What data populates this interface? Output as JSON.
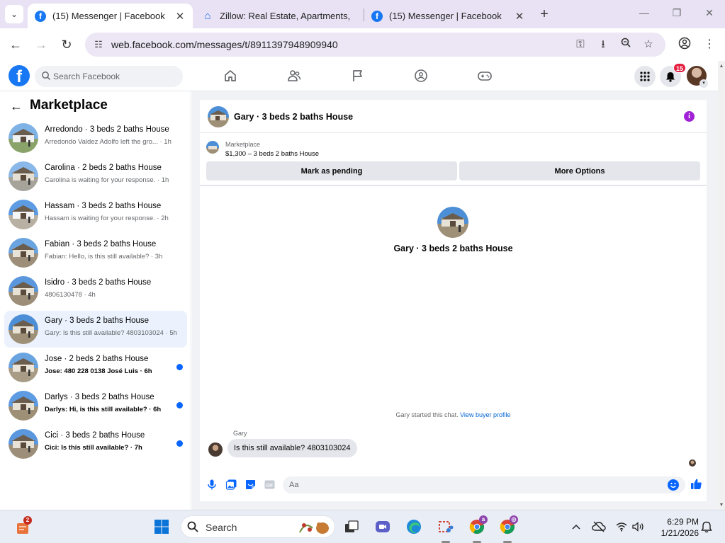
{
  "browser": {
    "tabs": [
      {
        "title": "(15) Messenger | Facebook",
        "icon": "facebook-icon",
        "active": true
      },
      {
        "title": "Zillow: Real Estate, Apartments,",
        "icon": "zillow-icon",
        "active": false
      },
      {
        "title": "(15) Messenger | Facebook",
        "icon": "facebook-icon",
        "active": false
      }
    ],
    "url": "web.facebook.com/messages/t/8911397948909940"
  },
  "header": {
    "logo": "f",
    "search_placeholder": "Search Facebook",
    "notification_count": "15"
  },
  "sidebar": {
    "title": "Marketplace",
    "conversations": [
      {
        "name": "Arredondo · 3 beds 2 baths House",
        "preview": "Arredondo Valdez Adolfo left the gro... · 1h",
        "unread": false,
        "selected": false
      },
      {
        "name": "Carolina · 2 beds 2 baths House",
        "preview": "Carolina is waiting for your response. · 1h",
        "unread": false,
        "selected": false
      },
      {
        "name": "Hassam · 3 beds 2 baths House",
        "preview": "Hassam is waiting for your response. · 2h",
        "unread": false,
        "selected": false
      },
      {
        "name": "Fabian · 3 beds 2 baths House",
        "preview": "Fabian: Hello, is this still available? · 3h",
        "unread": false,
        "selected": false
      },
      {
        "name": "Isidro · 3 beds 2 baths House",
        "preview": "4806130478 · 4h",
        "unread": false,
        "selected": false
      },
      {
        "name": "Gary · 3 beds 2 baths House",
        "preview": "Gary: Is this still available? 4803103024 · 5h",
        "unread": false,
        "selected": true
      },
      {
        "name": "Jose · 2 beds 2 baths House",
        "preview": "Jose: 480 228 0138 José Luis · 6h",
        "unread": true,
        "selected": false
      },
      {
        "name": "Darlys · 3 beds 2 baths House",
        "preview": "Darlys: Hi, is this still available? · 6h",
        "unread": true,
        "selected": false
      },
      {
        "name": "Cici · 3 beds 2 baths House",
        "preview": "Cici: Is this still available? · 7h",
        "unread": true,
        "selected": false
      }
    ]
  },
  "chat": {
    "title": "Gary · 3 beds 2 baths House",
    "listing_source": "Marketplace",
    "listing_price": "$1,300 – 3 beds 2 baths House",
    "mark_pending_label": "Mark as pending",
    "more_options_label": "More Options",
    "center_name": "Gary · 3 beds 2 baths House",
    "started_text": "Gary started this chat.",
    "view_profile_label": "View buyer profile",
    "sender": "Gary",
    "message": "Is this still available? 4803103024",
    "composer_placeholder": "Aa"
  },
  "taskbar": {
    "search_label": "Search",
    "time": "6:29 PM",
    "date": "1/21/2026",
    "widgets_badge": "2"
  },
  "colors": {
    "facebook_blue": "#1877f2",
    "messenger_blue": "#0866ff",
    "unread_dot": "#0866ff",
    "selected_row": "#ebf2fd",
    "notification_red": "#e41e3f",
    "info_purple": "#a121d6"
  }
}
